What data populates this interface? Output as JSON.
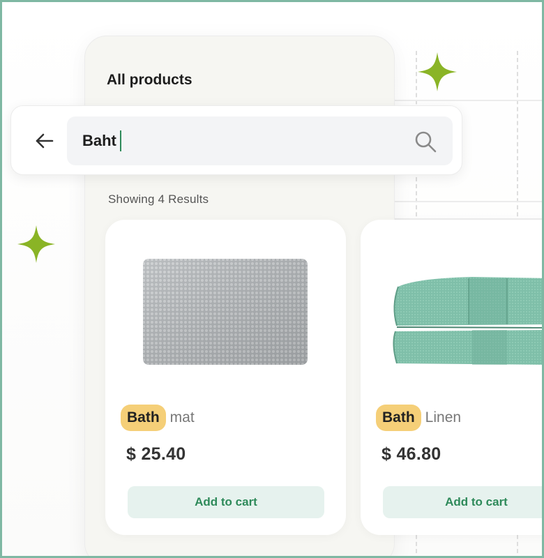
{
  "page": {
    "title": "All products"
  },
  "search": {
    "query": "Baht"
  },
  "results": {
    "summary": "Showing 4 Results"
  },
  "products": [
    {
      "name_highlight": "Bath",
      "name_rest": "mat",
      "price": "$ 25.40",
      "add_label": "Add to cart",
      "image": "grey-bath-mat"
    },
    {
      "name_highlight": "Bath",
      "name_rest": "Linen",
      "price": "$ 46.80",
      "add_label": "Add to cart",
      "image": "folded-green-towels"
    }
  ],
  "icons": {
    "back": "arrow-left-icon",
    "search": "search-icon",
    "sparkle": "sparkle-icon"
  },
  "colors": {
    "accent": "#2e8a5a",
    "highlight": "#f5cf78",
    "sparkle": "#8ab426",
    "button_bg": "#e6f2ee",
    "frame": "#7fb8a3"
  }
}
